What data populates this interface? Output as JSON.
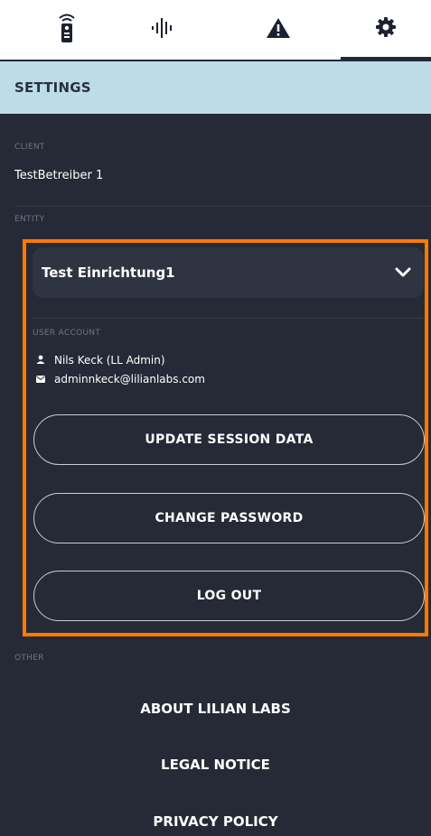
{
  "tabs": [
    {
      "name": "remote",
      "icon": "remote-icon"
    },
    {
      "name": "audio",
      "icon": "audio-wave-icon"
    },
    {
      "name": "alerts",
      "icon": "warning-icon"
    },
    {
      "name": "settings",
      "icon": "gear-icon"
    }
  ],
  "header": {
    "title": "SETTINGS"
  },
  "client": {
    "label": "CLIENT",
    "value": "TestBetreiber 1"
  },
  "entity": {
    "label": "ENTITY",
    "selected": "Test Einrichtung1"
  },
  "user_account": {
    "label": "USER ACCOUNT",
    "name": "Nils Keck (LL Admin)",
    "email": "adminnkeck@lilianlabs.com"
  },
  "buttons": {
    "update": "UPDATE SESSION DATA",
    "change_password": "CHANGE PASSWORD",
    "logout": "LOG OUT"
  },
  "other": {
    "label": "OTHER",
    "about": "ABOUT LILIAN LABS",
    "legal": "LEGAL NOTICE",
    "privacy": "PRIVACY POLICY"
  },
  "colors": {
    "background": "#262a36",
    "header_bar": "#bcdde8",
    "highlight": "#ff7a00"
  }
}
